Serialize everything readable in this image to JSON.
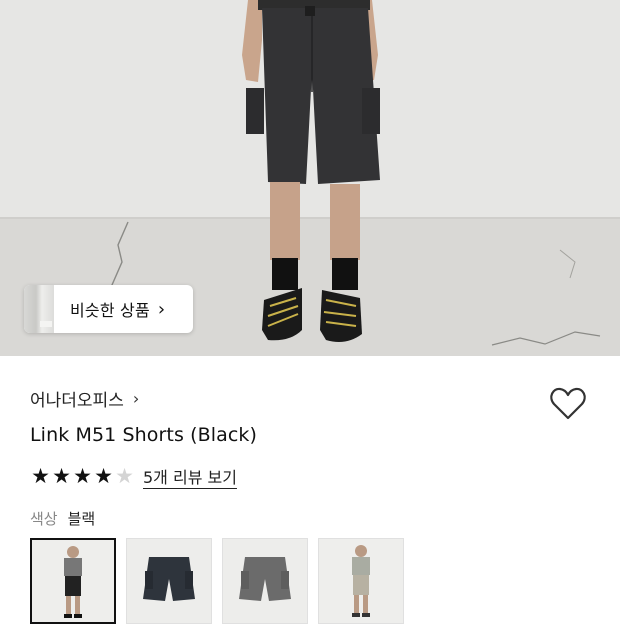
{
  "hero": {
    "image": "product-photo-model-wearing-black-shorts",
    "similar_button": {
      "label": "비슷한 상품",
      "icon": "chevron-right-icon"
    }
  },
  "product": {
    "brand": "어나더오피스",
    "brand_chevron": "›",
    "name": "Link M51 Shorts (Black)",
    "rating": 4,
    "rating_max": 5,
    "reviews_link": "5개 리뷰 보기",
    "color_label": "색상",
    "color_value": "블랙",
    "wishlist_icon": "heart-icon"
  },
  "colors": [
    "Black",
    "Navy",
    "Gray",
    "Beige"
  ],
  "theme": {
    "accent": "#111111",
    "muted": "#888888",
    "star_off": "#d4d4d4"
  }
}
